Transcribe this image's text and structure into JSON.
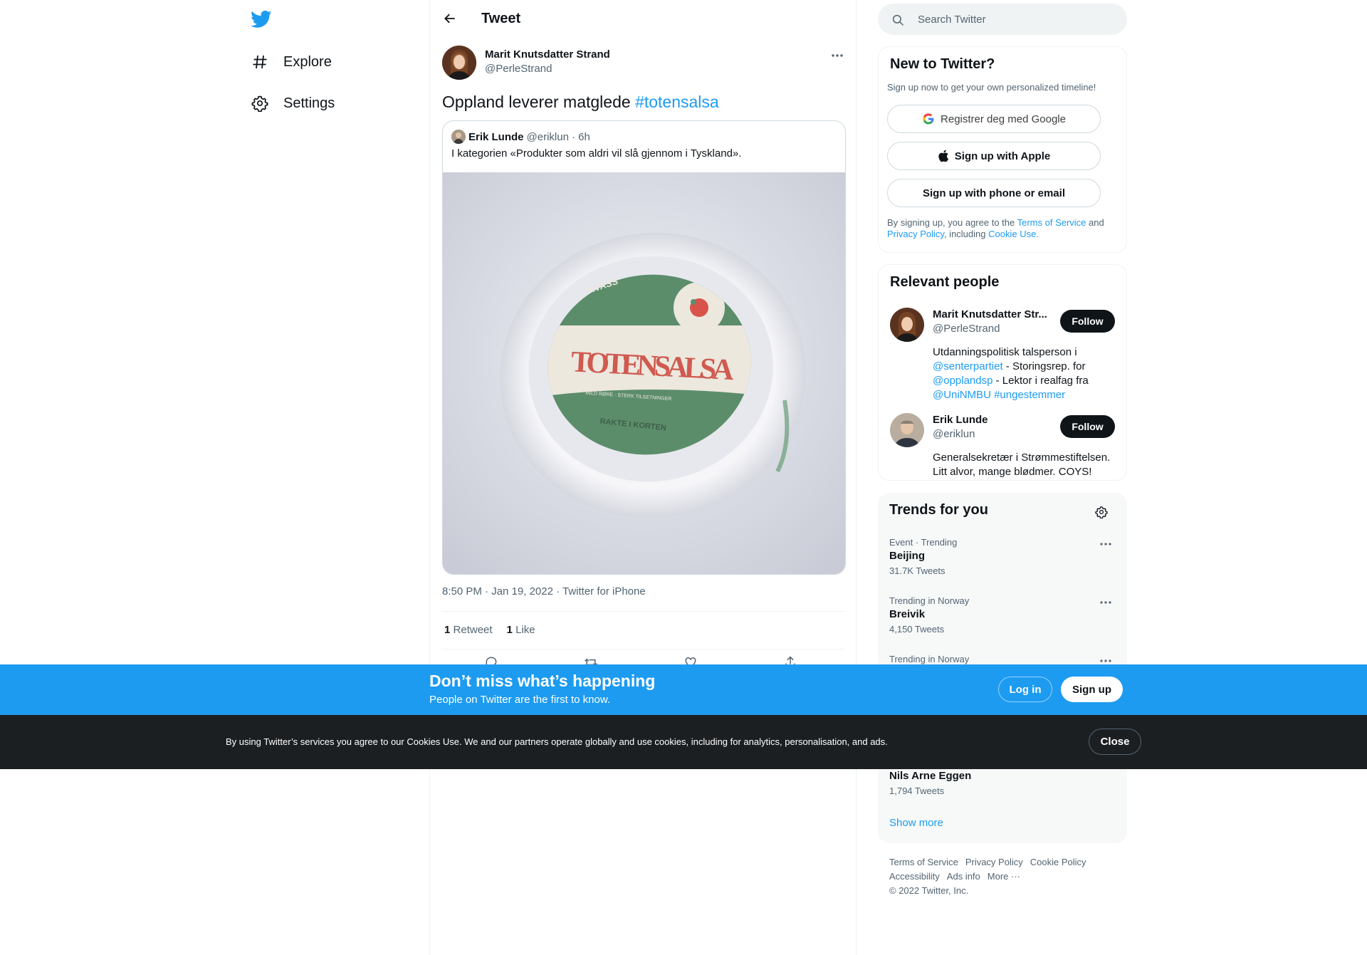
{
  "colors": {
    "accent": "#1d9bf0",
    "text": "#0f1419",
    "muted": "#536471",
    "cookie_bg": "#1c1f22"
  },
  "nav": {
    "items": [
      {
        "label": "Explore",
        "icon": "hashtag-icon"
      },
      {
        "label": "Settings",
        "icon": "gear-icon"
      }
    ]
  },
  "header": {
    "title": "Tweet"
  },
  "tweet": {
    "author_name": "Marit Knutsdatter Strand",
    "author_handle": "@PerleStrand",
    "text": "Oppland leverer matglede ",
    "hashtag": "#totensalsa",
    "timestamp": "8:50 PM · Jan 19, 2022 · Twitter for iPhone",
    "retweets_count": "1",
    "retweets_label": "Retweet",
    "likes_count": "1",
    "likes_label": "Like",
    "quoted": {
      "author_name": "Erik Lunde",
      "author_handle": "@eriklun",
      "time": "· 6h",
      "text": "I kategorien «Produkter som aldri vil slå gjennom i Tyskland».",
      "media_label_top": "KVASS",
      "media_label_main": "TOTENSALSA",
      "media_label_small": "MILD RØRE · STERK TILSETNINGER",
      "media_label_bottom": "RAKTE I KORTEN"
    }
  },
  "search": {
    "placeholder": "Search Twitter"
  },
  "new_to_twitter": {
    "title": "New to Twitter?",
    "subtitle": "Sign up now to get your own personalized timeline!",
    "google_label": "Registrer deg med Google",
    "apple_label": "Sign up with Apple",
    "phone_label": "Sign up with phone or email",
    "legal_prefix": "By signing up, you agree to the ",
    "terms_link": "Terms of Service",
    "legal_and": " and ",
    "privacy_link": "Privacy Policy",
    "legal_including": ", including ",
    "cookie_link": "Cookie Use."
  },
  "relevant_people": {
    "title": "Relevant people",
    "people": [
      {
        "name": "Marit Knutsdatter Str...",
        "handle": "@PerleStrand",
        "follow_label": "Follow",
        "bio_1": "Utdanningspolitisk talsperson i ",
        "bio_link_1": "@senterpartiet",
        "bio_2": " - Storingsrep. for ",
        "bio_link_2": "@opplandsp",
        "bio_3": " - Lektor i realfag fra ",
        "bio_link_3": "@UniNMBU",
        "bio_link_4": "#ungestemmer"
      },
      {
        "name": "Erik Lunde",
        "handle": "@eriklun",
        "follow_label": "Follow",
        "bio": "Generalsekretær i Strømmestiftelsen. Litt alvor, mange blødmer. COYS!"
      }
    ]
  },
  "trends": {
    "title": "Trends for you",
    "items": [
      {
        "meta": "Event · Trending",
        "name": "Beijing",
        "count": "31.7K Tweets"
      },
      {
        "meta": "Trending in Norway",
        "name": "Breivik",
        "count": "4,150 Tweets"
      },
      {
        "meta": "Trending in Norway",
        "name": "",
        "count": ""
      },
      {
        "meta": "",
        "name": "Nils Arne Eggen",
        "count": "1,794 Tweets"
      }
    ],
    "show_more": "Show more"
  },
  "footer": {
    "links": [
      "Terms of Service",
      "Privacy Policy",
      "Cookie Policy",
      "Accessibility",
      "Ads info",
      "More ···"
    ],
    "copyright": "© 2022 Twitter, Inc."
  },
  "signup_bar": {
    "title": "Don’t miss what’s happening",
    "subtitle": "People on Twitter are the first to know.",
    "login_label": "Log in",
    "signup_label": "Sign up"
  },
  "cookie_bar": {
    "text": "By using Twitter’s services you agree to our Cookies Use. We and our partners operate globally and use cookies, including for analytics, personalisation, and ads.",
    "close_label": "Close"
  }
}
